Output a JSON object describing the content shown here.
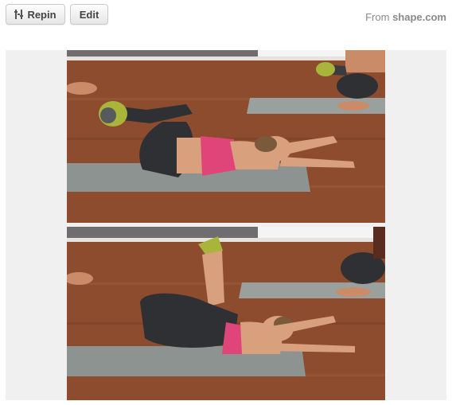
{
  "toolbar": {
    "repin_label": "Repin",
    "edit_label": "Edit"
  },
  "source": {
    "prefix": "From",
    "domain": "shape.com"
  },
  "photos": [
    {
      "name": "exercise-photo-step-1",
      "icon": "exercise-photo"
    },
    {
      "name": "exercise-photo-step-2",
      "icon": "exercise-photo"
    }
  ],
  "colors": {
    "floor": "#8a4a2c",
    "wall": "#f3f1f1",
    "mat": "#8d9390",
    "top": "#e0457a",
    "leggings": "#2e3034",
    "skin": "#d9a07e",
    "shoe": "#a8b43a"
  }
}
